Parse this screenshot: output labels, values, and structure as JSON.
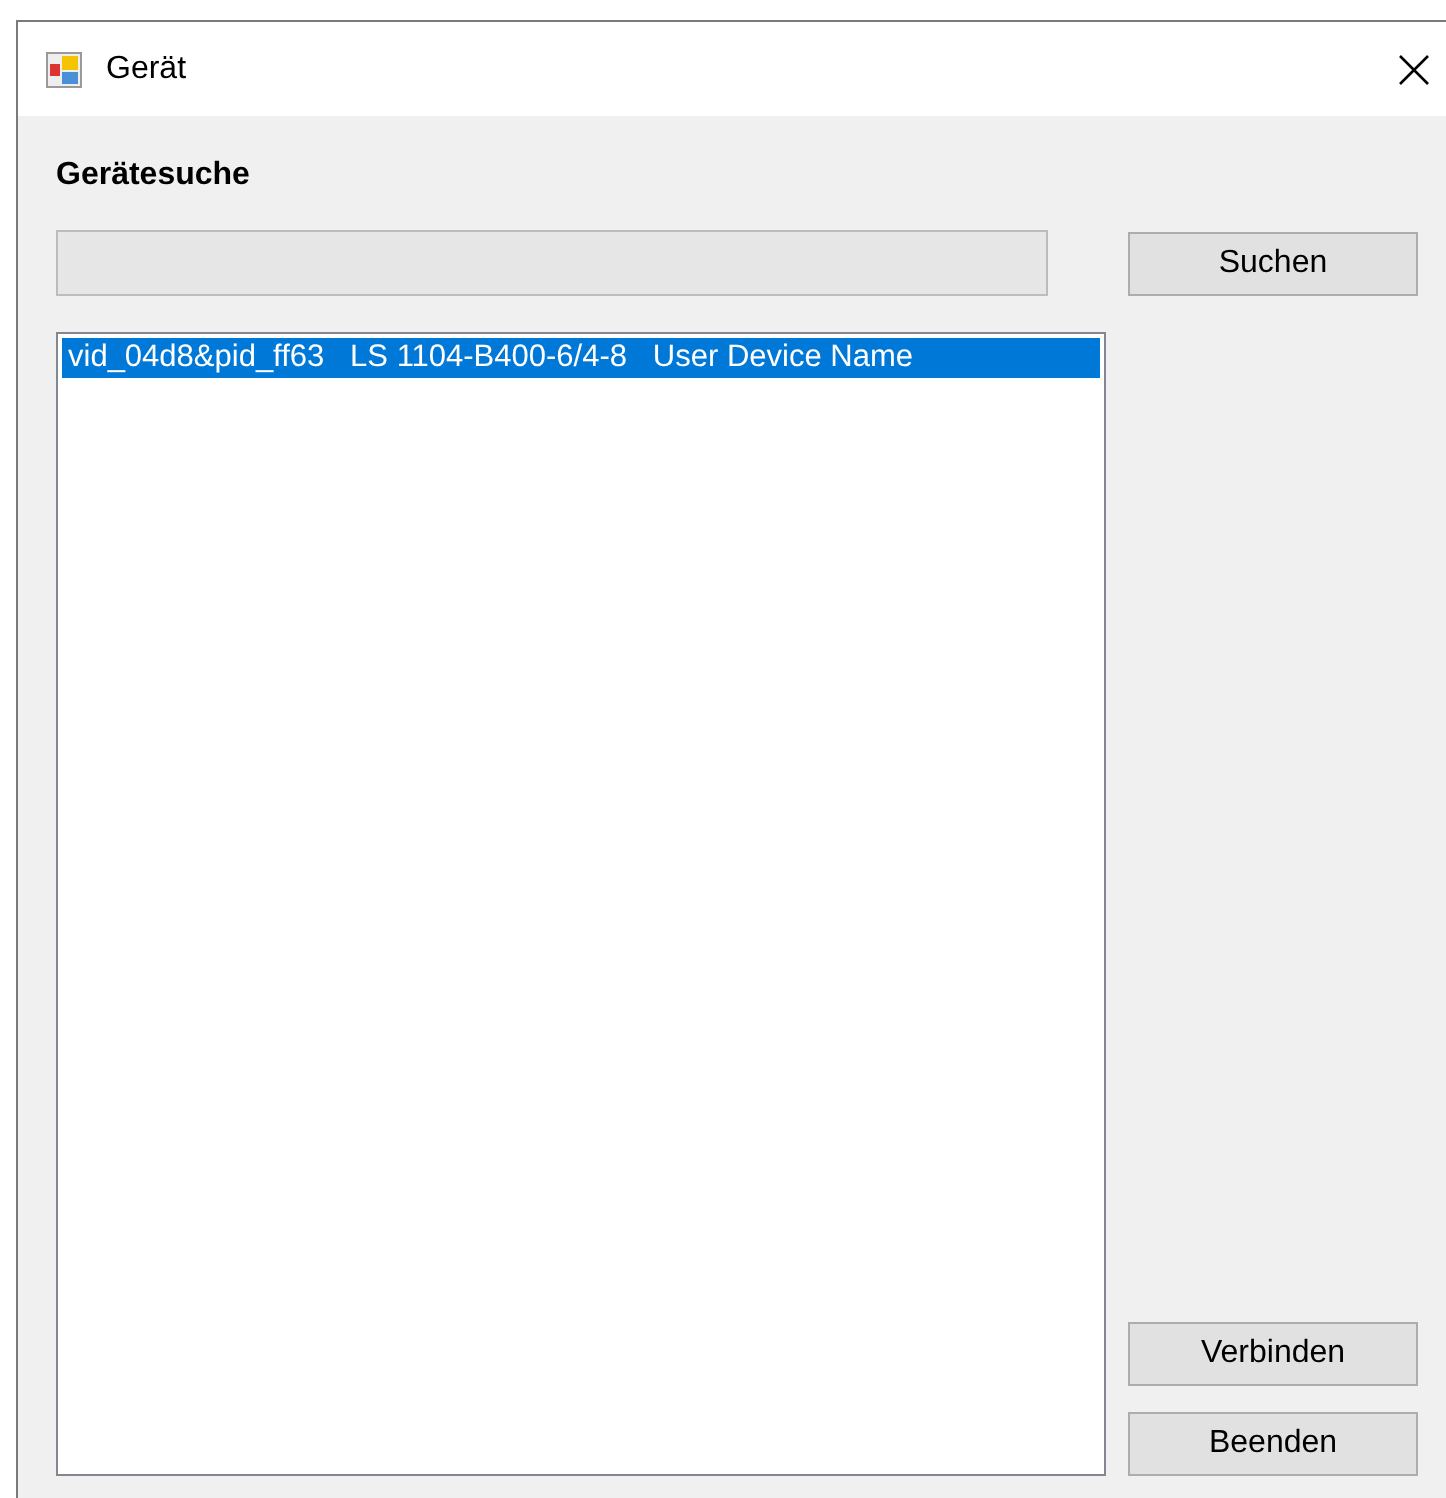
{
  "window": {
    "title": "Gerät"
  },
  "section_label": "Gerätesuche",
  "search_button": "Suchen",
  "devices": [
    {
      "text": "vid_04d8&pid_ff63   LS 1104-B400-6/4-8   User Device Name",
      "selected": true
    }
  ],
  "buttons": [
    "Verbinden",
    "Beenden"
  ]
}
